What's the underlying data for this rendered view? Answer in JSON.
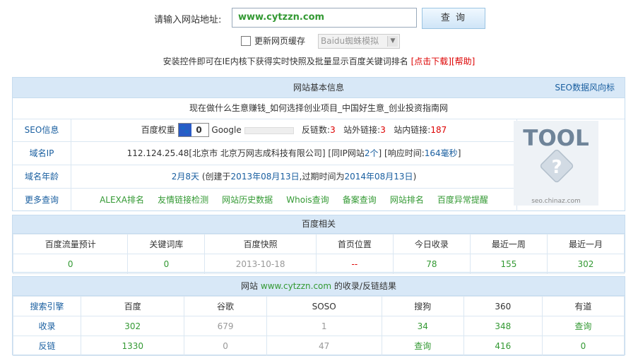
{
  "search": {
    "label": "请输入网站地址:",
    "value": "www.cytzzn.com",
    "button": "查 询",
    "refresh_label": "更新网页缓存",
    "spider_value": "Baidu蜘蛛模拟",
    "install_text": "安装控件即可在IE内核下获得实时快照及批量显示百度关键词排名",
    "download_link": "[点击下载]",
    "help_link": "[帮助]"
  },
  "basic": {
    "header": "网站基本信息",
    "trend_link": "SEO数据风向标",
    "site_title": "现在做什么生意赚钱_如何选择创业项目_中国好生意_创业投资指南网",
    "seo": {
      "label": "SEO信息",
      "baidu_weight_label": "百度权重",
      "baidu_weight": "0",
      "google_label": "Google",
      "backlinks_label": "反链数:",
      "backlinks": "3",
      "outlinks_label": "站外链接:",
      "outlinks": "3",
      "inlinks_label": "站内链接:",
      "inlinks": "187"
    },
    "ip": {
      "label": "域名IP",
      "ip_text": "112.124.25.48[北京市 北京万网志成科技有限公司]",
      "same_ip_prefix": "[同IP网站",
      "same_ip_count": "2个",
      "same_ip_suffix": "]",
      "resp_prefix": "[响应时间:",
      "resp_value": "164毫秒",
      "resp_suffix": "]"
    },
    "age": {
      "label": "域名年龄",
      "age": "2月8天",
      "created_prefix": "(创建于",
      "created": "2013年08月13日",
      "expire_prefix": ",过期时间为",
      "expire": "2014年08月13日",
      "suffix": ")"
    },
    "more": {
      "label": "更多查询",
      "links": [
        "ALEXA排名",
        "友情链接检测",
        "网站历史数据",
        "Whois查询",
        "备案查询",
        "网站排名",
        "百度异常提醒"
      ]
    },
    "logo_text": "TOOL",
    "logo_caption": "seo.chinaz.com"
  },
  "baidu": {
    "header": "百度相关",
    "columns": [
      "百度流量预计",
      "关键词库",
      "百度快照",
      "首页位置",
      "今日收录",
      "最近一周",
      "最近一月"
    ],
    "values": [
      "0",
      "0",
      "2013-10-18",
      "--",
      "78",
      "155",
      "302"
    ]
  },
  "engines": {
    "header_prefix": "网站",
    "header_site": "www.cytzzn.com",
    "header_suffix": "的收录/反链结果",
    "columns": [
      "搜索引擎",
      "百度",
      "谷歌",
      "SOSO",
      "搜狗",
      "360",
      "有道"
    ],
    "index_row": [
      "收录",
      "302",
      "679",
      "1",
      "34",
      "348",
      "查询"
    ],
    "backlink_row": [
      "反链",
      "1330",
      "0",
      "47",
      "查询",
      "416",
      "0"
    ]
  }
}
